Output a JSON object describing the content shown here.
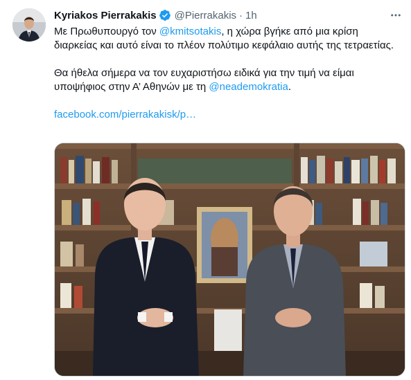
{
  "author": {
    "name": "Kyriakos Pierrakakis",
    "handle": "@Pierrakakis",
    "separator": "·",
    "time": "1h"
  },
  "tweet": {
    "line1_pre": "Με Πρωθυπουργό τον ",
    "mention1": "@kmitsotakis",
    "line1_post": ", η χώρα βγήκε από μια κρίση διαρκείας και αυτό είναι το πλέον πολύτιμο κεφάλαιο αυτής της τετραετίας.",
    "line2_pre": "Θα ήθελα σήμερα να τον ευχαριστήσω ειδικά για την τιμή να είμαι υποψήφιος στην Α’ Αθηνών με τη ",
    "mention2": "@neademokratia",
    "line2_post": ".",
    "link": "facebook.com/pierrakakisk/p…"
  },
  "colors": {
    "link": "#1d9bf0",
    "secondary_text": "#536471",
    "verified_badge": "#1d9bf0"
  },
  "icons": {
    "verified": "verified-badge-icon",
    "more": "more-dots-icon"
  }
}
